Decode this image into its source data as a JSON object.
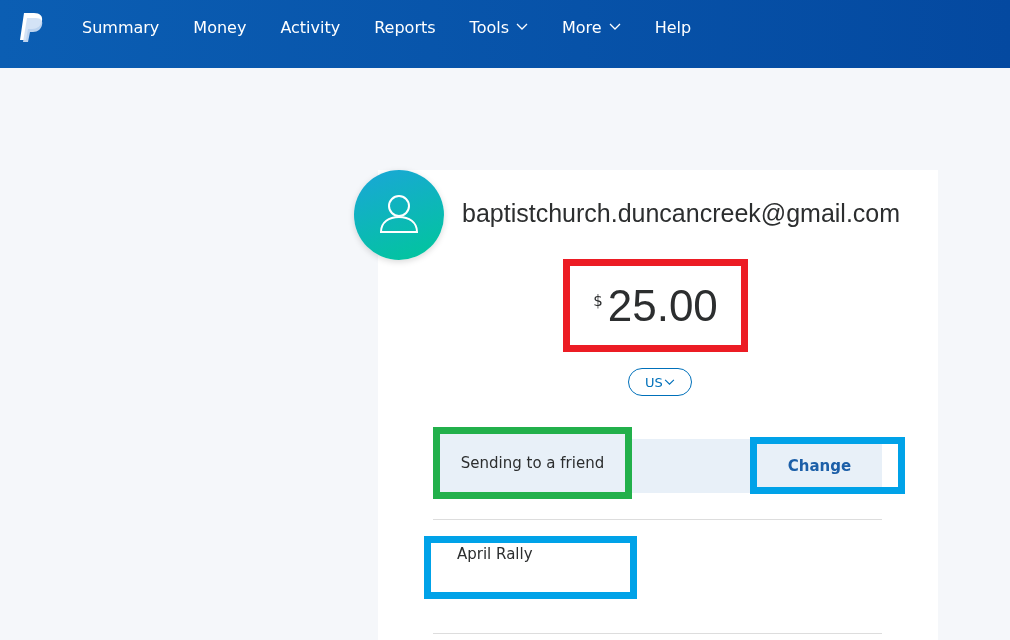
{
  "nav": {
    "items": [
      {
        "label": "Summary",
        "dropdown": false
      },
      {
        "label": "Money",
        "dropdown": false
      },
      {
        "label": "Activity",
        "dropdown": false
      },
      {
        "label": "Reports",
        "dropdown": false
      },
      {
        "label": "Tools",
        "dropdown": true
      },
      {
        "label": "More",
        "dropdown": true
      },
      {
        "label": "Help",
        "dropdown": false
      }
    ]
  },
  "recipient": {
    "email": "baptistchurch.duncancreek@gmail.com"
  },
  "amount": {
    "symbol": "$",
    "value": "25.00",
    "color": "#ec1c24"
  },
  "currency": {
    "label": "US"
  },
  "purpose": {
    "label": "Sending to a friend",
    "color": "#22b04b",
    "button": {
      "label": "Change",
      "color": "#00a2e8"
    }
  },
  "note": {
    "text": "April Rally",
    "color": "#00a2e8"
  }
}
